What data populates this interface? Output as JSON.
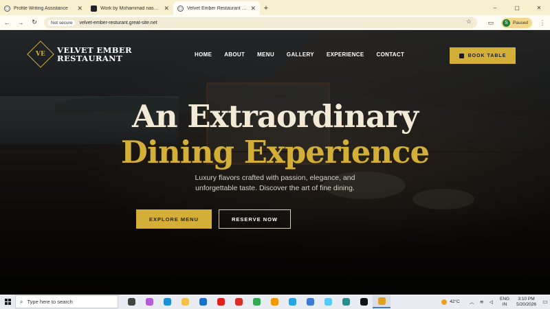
{
  "browser": {
    "tabs": [
      {
        "title": "Profile Writing Assistance",
        "favicon": "globe-icon",
        "active": false
      },
      {
        "title": "Work by Mohammad nashim",
        "favicon": "site-icon",
        "active": false
      },
      {
        "title": "Velvet Ember Restaurant | Ultra",
        "favicon": "globe-icon",
        "active": true
      }
    ],
    "new_tab": "+",
    "window_controls": {
      "minimize": "–",
      "maximize": "▢",
      "close": "✕"
    },
    "nav": {
      "back": "←",
      "forward": "→",
      "reload": "↻"
    },
    "security_badge": "Not secure",
    "url": "velvet-ember-resturant.great-site.net",
    "profile": {
      "initial": "S",
      "status": "Paused"
    }
  },
  "site": {
    "logo_mark": "VE",
    "logo_line1": "VELVET EMBER",
    "logo_line2": "RESTAURANT",
    "nav": [
      "HOME",
      "ABOUT",
      "MENU",
      "GALLERY",
      "EXPERIENCE",
      "CONTACT"
    ],
    "book_button": "BOOK TABLE",
    "hero_line1": "An Extraordinary",
    "hero_line2": "Dining Experience",
    "subtitle_line1": "Luxury flavors crafted with passion, elegance, and",
    "subtitle_line2": "unforgettable taste. Discover the art of fine dining.",
    "primary_cta": "EXPLORE MENU",
    "secondary_cta": "RESERVE NOW",
    "colors": {
      "gold": "#d4af37",
      "cream": "#f3ead5"
    }
  },
  "taskbar": {
    "search_placeholder": "Type here to search",
    "weather": "42°C",
    "lang_line1": "ENG",
    "lang_line2": "IN",
    "time": "3:10 PM",
    "date": "5/20/2026",
    "apps": [
      {
        "name": "task-view",
        "color": "#444"
      },
      {
        "name": "copilot",
        "color": "#b25ed6"
      },
      {
        "name": "edge",
        "color": "#1e8fd6"
      },
      {
        "name": "file-explorer",
        "color": "#f2c14e"
      },
      {
        "name": "outlook",
        "color": "#1a6fc9"
      },
      {
        "name": "youtube",
        "color": "#e02020"
      },
      {
        "name": "gmail",
        "color": "#d93025"
      },
      {
        "name": "drive",
        "color": "#34a853"
      },
      {
        "name": "photos",
        "color": "#f29900"
      },
      {
        "name": "telegram",
        "color": "#2aa3e0"
      },
      {
        "name": "screenshot",
        "color": "#3a7bd5"
      },
      {
        "name": "sky-app",
        "color": "#5ac8fa"
      },
      {
        "name": "snip",
        "color": "#2e8b8b"
      },
      {
        "name": "capcut",
        "color": "#111"
      },
      {
        "name": "chrome",
        "color": "#e0a020"
      }
    ]
  }
}
